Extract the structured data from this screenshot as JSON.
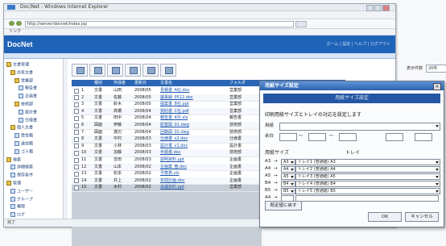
{
  "window": {
    "title": "Doc/Net - Windows Internet Explorer",
    "address": "http://server/docnet/index.jsp",
    "links_label": "リンク"
  },
  "app": {
    "logo": "DocNet",
    "header_links": "ホーム | 設定 | ヘルプ | ログアウト",
    "pager_label": "表示件数",
    "pager_value": "20件"
  },
  "sidebar": {
    "items": [
      {
        "label": "文書管理",
        "icon": "folder-icon",
        "indent": 0
      },
      {
        "label": "共有文書",
        "icon": "folder-icon",
        "indent": 1
      },
      {
        "label": "営業部",
        "icon": "folder-icon",
        "indent": 2
      },
      {
        "label": "報告書",
        "icon": "doc-icon",
        "indent": 3
      },
      {
        "label": "企画書",
        "icon": "doc-icon",
        "indent": 3
      },
      {
        "label": "技術部",
        "icon": "folder-icon",
        "indent": 2
      },
      {
        "label": "設計書",
        "icon": "doc-icon",
        "indent": 3
      },
      {
        "label": "仕様書",
        "icon": "doc-icon",
        "indent": 3
      },
      {
        "label": "個人文書",
        "icon": "folder-icon",
        "indent": 1
      },
      {
        "label": "受信箱",
        "icon": "doc-icon",
        "indent": 2
      },
      {
        "label": "送信箱",
        "icon": "doc-icon",
        "indent": 2
      },
      {
        "label": "ゴミ箱",
        "icon": "doc-icon",
        "indent": 2
      },
      {
        "label": "検索",
        "icon": "folder-icon",
        "indent": 0
      },
      {
        "label": "詳細検索",
        "icon": "doc-icon",
        "indent": 1
      },
      {
        "label": "保存条件",
        "icon": "doc-icon",
        "indent": 1
      },
      {
        "label": "管理",
        "icon": "folder-icon",
        "indent": 0
      },
      {
        "label": "ユーザー",
        "icon": "doc-icon",
        "indent": 1
      },
      {
        "label": "グループ",
        "icon": "doc-icon",
        "indent": 1
      },
      {
        "label": "権限",
        "icon": "doc-icon",
        "indent": 1
      },
      {
        "label": "ログ",
        "icon": "doc-icon",
        "indent": 1
      }
    ]
  },
  "grid": {
    "columns": [
      "",
      "種別",
      "作成者",
      "更新日",
      "文書名",
      "フォルダ"
    ],
    "rows": [
      [
        "1",
        "文書",
        "山田",
        "2008/05",
        "見積書_A社.doc",
        "営業部"
      ],
      [
        "2",
        "文書",
        "佐藤",
        "2008/05",
        "議事録_0512.doc",
        "営業部"
      ],
      [
        "3",
        "文書",
        "鈴木",
        "2008/05",
        "提案書_B社.ppt",
        "営業部"
      ],
      [
        "4",
        "文書",
        "高橋",
        "2008/04",
        "契約書_C社.pdf",
        "営業部"
      ],
      [
        "5",
        "文書",
        "田中",
        "2008/04",
        "報告書_4月.xls",
        "報告書"
      ],
      [
        "6",
        "図面",
        "伊藤",
        "2008/04",
        "配置図_01.dwg",
        "技術部"
      ],
      [
        "7",
        "図面",
        "渡辺",
        "2008/04",
        "回路図_02.dwg",
        "技術部"
      ],
      [
        "8",
        "文書",
        "中村",
        "2008/03",
        "仕様書_v2.doc",
        "仕様書"
      ],
      [
        "9",
        "文書",
        "小林",
        "2008/03",
        "設計書_v1.doc",
        "設計書"
      ],
      [
        "10",
        "文書",
        "加藤",
        "2008/03",
        "手順書.doc",
        "技術部"
      ],
      [
        "11",
        "文書",
        "吉田",
        "2008/03",
        "説明資料.ppt",
        "企画書"
      ],
      [
        "12",
        "文書",
        "山本",
        "2008/02",
        "企画案_春.doc",
        "企画書"
      ],
      [
        "13",
        "文書",
        "松本",
        "2008/02",
        "予算表.xls",
        "企画書"
      ],
      [
        "14",
        "文書",
        "井上",
        "2008/02",
        "年間計画.doc",
        "企画書"
      ],
      [
        "15",
        "文書",
        "木村",
        "2008/02",
        "会議資料.ppt",
        "営業部"
      ]
    ]
  },
  "status": "完了",
  "dialog": {
    "title": "用紙サイズ設定",
    "banner": "用紙サイズ設定",
    "heading": "印刷用紙サイズとトレイの対応を設定します",
    "row1_label": "用紙",
    "row2_label": "余白",
    "row2_sep": "〜",
    "table_header_size": "用紙サイズ",
    "table_header_tray": "トレイ",
    "table_rows": [
      {
        "size": "A3",
        "arrow": "→",
        "sel": "A3",
        "tray": "トレイ1 (普通紙) A3"
      },
      {
        "size": "A4",
        "arrow": "→",
        "sel": "A4",
        "tray": "トレイ2 (普通紙) A4"
      },
      {
        "size": "A5",
        "arrow": "→",
        "sel": "A5",
        "tray": "トレイ3 (普通紙) A5"
      },
      {
        "size": "B4",
        "arrow": "→",
        "sel": "B4",
        "tray": "トレイ4 (普通紙) B4"
      },
      {
        "size": "B5",
        "arrow": "→",
        "sel": "B5",
        "tray": "トレイ5 (普通紙) B5"
      },
      {
        "size": "A4",
        "arrow": "→",
        "sel": "",
        "tray": ""
      }
    ],
    "default_button": "既定値に戻す",
    "ok_button": "OK",
    "cancel_button": "キャンセル"
  }
}
